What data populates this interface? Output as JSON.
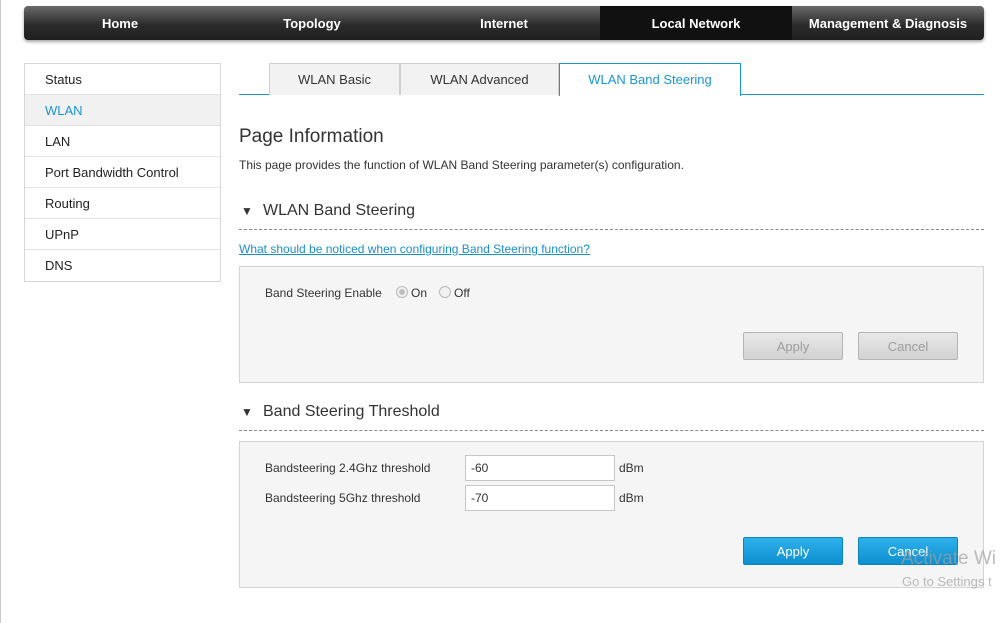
{
  "topnav": {
    "items": [
      {
        "label": "Home"
      },
      {
        "label": "Topology"
      },
      {
        "label": "Internet"
      },
      {
        "label": "Local Network"
      },
      {
        "label": "Management & Diagnosis"
      }
    ],
    "active_index": 3
  },
  "sidebar": {
    "items": [
      {
        "label": "Status"
      },
      {
        "label": "WLAN"
      },
      {
        "label": "LAN"
      },
      {
        "label": "Port Bandwidth Control"
      },
      {
        "label": "Routing"
      },
      {
        "label": "UPnP"
      },
      {
        "label": "DNS"
      }
    ],
    "active_index": 1
  },
  "tabs": {
    "items": [
      {
        "label": "WLAN Basic"
      },
      {
        "label": "WLAN Advanced"
      },
      {
        "label": "WLAN Band Steering"
      }
    ],
    "active_index": 2
  },
  "page": {
    "title": "Page Information",
    "description": "This page provides the function of WLAN Band Steering parameter(s) configuration."
  },
  "band_steering": {
    "section_title": "WLAN Band Steering",
    "help_link": "What should be noticed when configuring Band Steering function?",
    "enable_label": "Band Steering Enable",
    "option_on": "On",
    "option_off": "Off",
    "selected": "On",
    "apply_label": "Apply",
    "cancel_label": "Cancel"
  },
  "threshold": {
    "section_title": "Band Steering Threshold",
    "fields": [
      {
        "label": "Bandsteering 2.4Ghz threshold",
        "value": "-60",
        "unit": "dBm"
      },
      {
        "label": "Bandsteering 5Ghz threshold",
        "value": "-70",
        "unit": "dBm"
      }
    ],
    "apply_label": "Apply",
    "cancel_label": "Cancel"
  },
  "watermark": {
    "line1": "Activate Wi",
    "line2": "Go to Settings t"
  },
  "colors": {
    "accent": "#1a95d2",
    "nav_bg": "#2c2c2c"
  }
}
